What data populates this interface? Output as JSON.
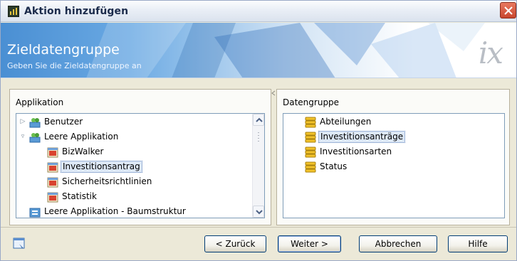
{
  "window": {
    "title": "Aktion hinzufügen"
  },
  "banner": {
    "title": "Zieldatengruppe",
    "subtitle": "Geben Sie die Zieldatengruppe an",
    "logo": "ix"
  },
  "left_panel": {
    "label": "Applikation",
    "tree": [
      {
        "label": "Benutzer",
        "level": 0,
        "icon": "users-app-icon",
        "expander": "collapsed",
        "selected": false
      },
      {
        "label": "Leere Applikation",
        "level": 0,
        "icon": "users-app-icon",
        "expander": "expanded",
        "selected": false
      },
      {
        "label": "BizWalker",
        "level": 1,
        "icon": "app-module-icon",
        "selected": false
      },
      {
        "label": "Investitionsantrag",
        "level": 1,
        "icon": "app-module-icon",
        "selected": true
      },
      {
        "label": "Sicherheitsrichtlinien",
        "level": 1,
        "icon": "app-module-icon",
        "selected": false
      },
      {
        "label": "Statistik",
        "level": 1,
        "icon": "app-module-icon",
        "selected": false
      },
      {
        "label": "Leere Applikation - Baumstruktur",
        "level": 0,
        "icon": "tree-app-icon",
        "selected": false
      }
    ]
  },
  "right_panel": {
    "label": "Datengruppe",
    "items": [
      {
        "label": "Abteilungen",
        "icon": "database-icon",
        "selected": false
      },
      {
        "label": "Investitionsanträge",
        "icon": "database-icon",
        "selected": true
      },
      {
        "label": "Investitionsarten",
        "icon": "database-icon",
        "selected": false
      },
      {
        "label": "Status",
        "icon": "database-icon",
        "selected": false
      }
    ]
  },
  "footer": {
    "back_label": "< Zurück",
    "next_label": "Weiter >",
    "cancel_label": "Abbrechen",
    "help_label": "Hilfe"
  },
  "colors": {
    "accent": "#4a8fd3",
    "selection": "#dde8f6",
    "close": "#c8462e"
  }
}
